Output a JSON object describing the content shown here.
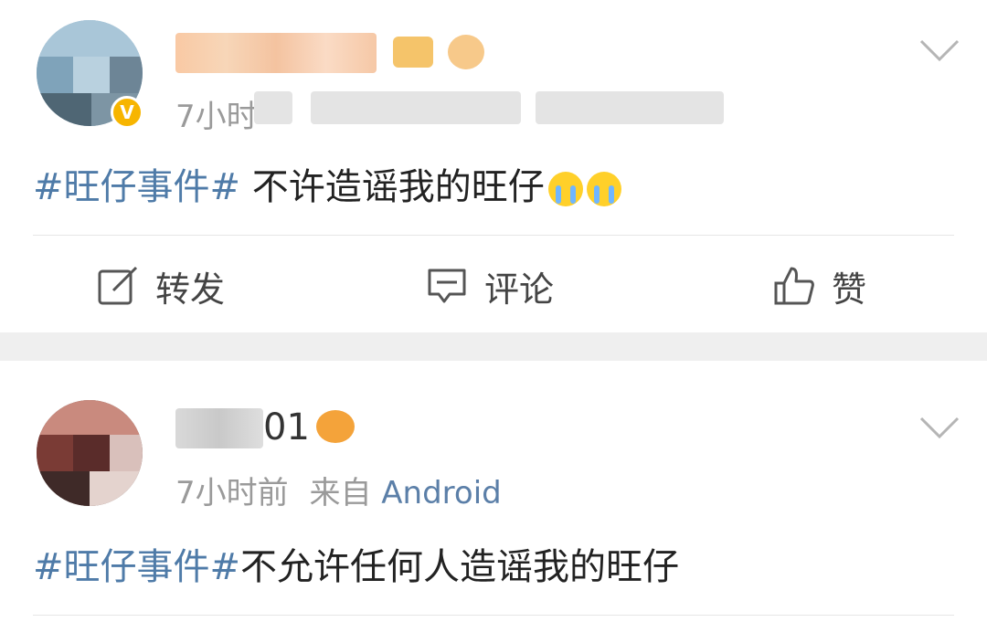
{
  "posts": [
    {
      "meta_time": "7小时",
      "content_tag": "#旺仔事件#",
      "content_text": " 不许造谣我的旺仔",
      "emojis": [
        "crying-face",
        "crying-face"
      ],
      "verified_badge": "V",
      "actions": {
        "repost_label": "转发",
        "comment_label": "评论",
        "like_label": "赞"
      }
    },
    {
      "name_visible_part": "01",
      "meta_time": "7小时前",
      "meta_from": "来自",
      "meta_source": "Android",
      "content_tag": "#旺仔事件#",
      "content_text": "不允许任何人造谣我的旺仔"
    }
  ],
  "colors": {
    "hashtag": "#4f7ba8",
    "source_link": "#5b7fa8",
    "meta_gray": "#9a9a9a",
    "verified_badge": "#f7b500",
    "separator": "#efefef"
  }
}
